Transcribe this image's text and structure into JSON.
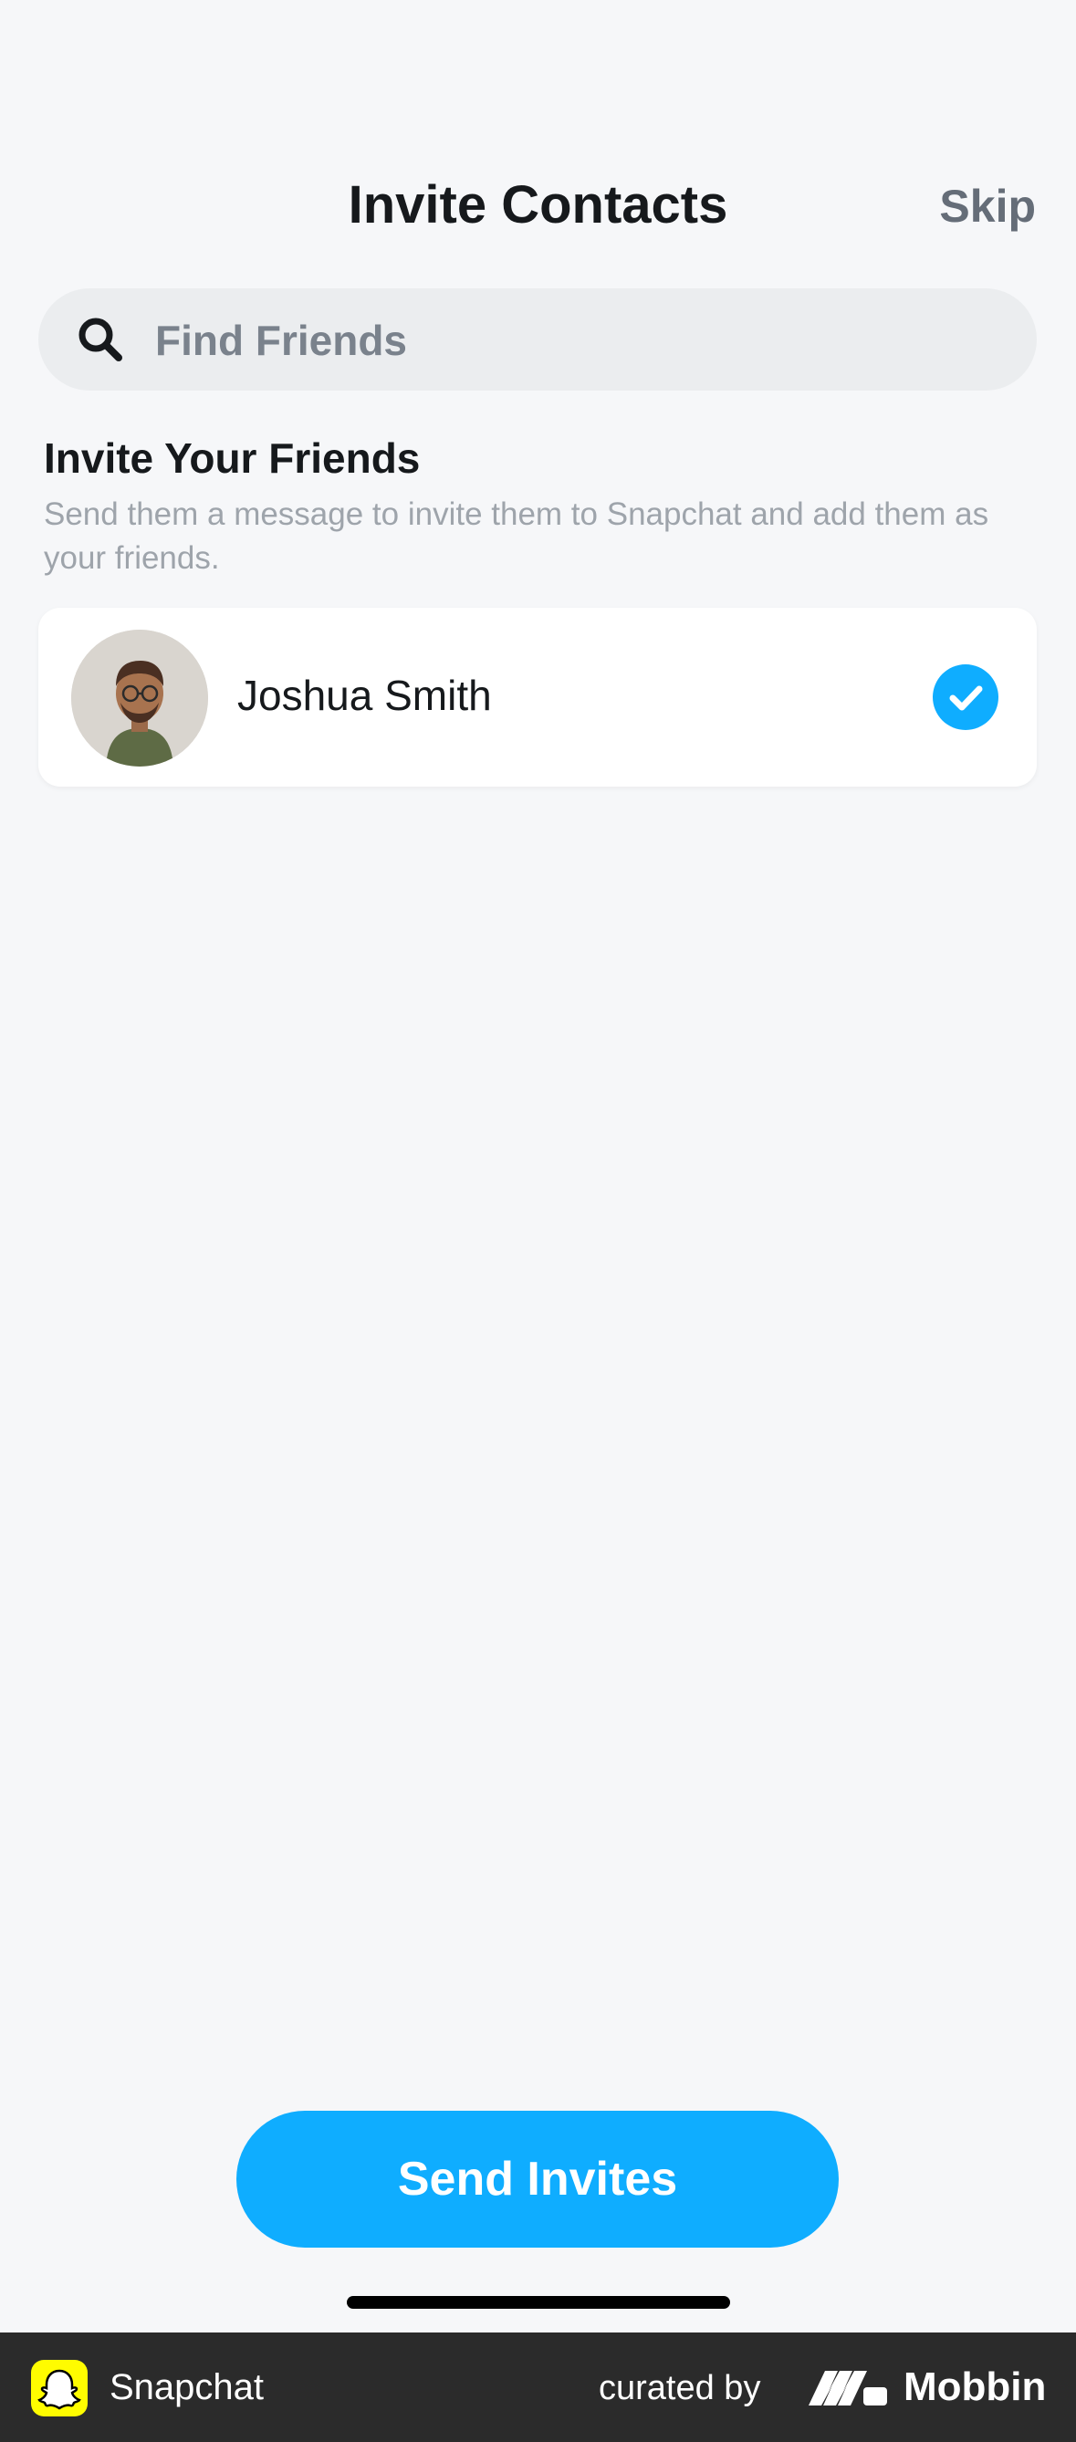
{
  "header": {
    "title": "Invite Contacts",
    "skip_label": "Skip"
  },
  "search": {
    "placeholder": "Find Friends",
    "icon": "search-icon"
  },
  "section": {
    "title": "Invite Your Friends",
    "description": "Send them a message to invite them to Snapchat and add them as your friends."
  },
  "contacts": [
    {
      "name": "Joshua Smith",
      "selected": true,
      "avatar": "memoji-avatar"
    }
  ],
  "actions": {
    "send_label": "Send Invites"
  },
  "footer": {
    "app_name": "Snapchat",
    "curated_by": "curated by",
    "brand": "Mobbin"
  },
  "colors": {
    "accent": "#0fadff",
    "background": "#f6f7f9",
    "snapchat_yellow": "#fffc00",
    "footer_bg": "#2b2b2b"
  }
}
